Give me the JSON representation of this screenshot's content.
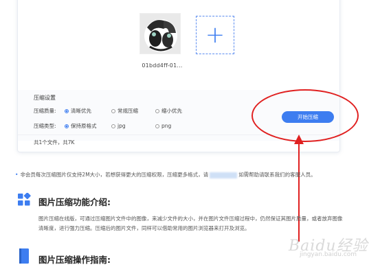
{
  "upload": {
    "file_name": "01bdd4ff-01...",
    "add_icon": "plus-icon"
  },
  "settings": {
    "title": "压缩设置",
    "quality": {
      "label": "压缩质量:",
      "options": [
        "清晰优先",
        "常规压缩",
        "缩小优先"
      ],
      "selected": "清晰优先"
    },
    "type": {
      "label": "压缩类型:",
      "options": [
        "保持原格式",
        "jpg",
        "png"
      ],
      "selected": "保持原格式"
    },
    "start_button": "开始压缩",
    "summary": "共1个文件，共7K"
  },
  "notice": {
    "text_before": "非会员每次压缩图片仅支持2M大小，若想获得更大的压缩权限，压缩更多格式，请",
    "text_after": "如需帮助请联系我们的客服人员。"
  },
  "intro": {
    "title": "图片压缩功能介绍:",
    "body": "图片压缩在线版，可通过压缩图片文件中的图像，来减少文件的大小，并在图片文件压缩过程中，仍然保证其图片质量，或者放弃图像清晰度，进行强力压缩。压缩后的图片文件，同样可以借助常用的图片浏览器来打开及浏览。"
  },
  "guide": {
    "title": "图片压缩操作指南:"
  },
  "watermark": {
    "text": "Baidu经验",
    "sub": "jingyan.baidu.com"
  },
  "colors": {
    "accent": "#3d7df0",
    "annotation_red": "#e02020"
  }
}
